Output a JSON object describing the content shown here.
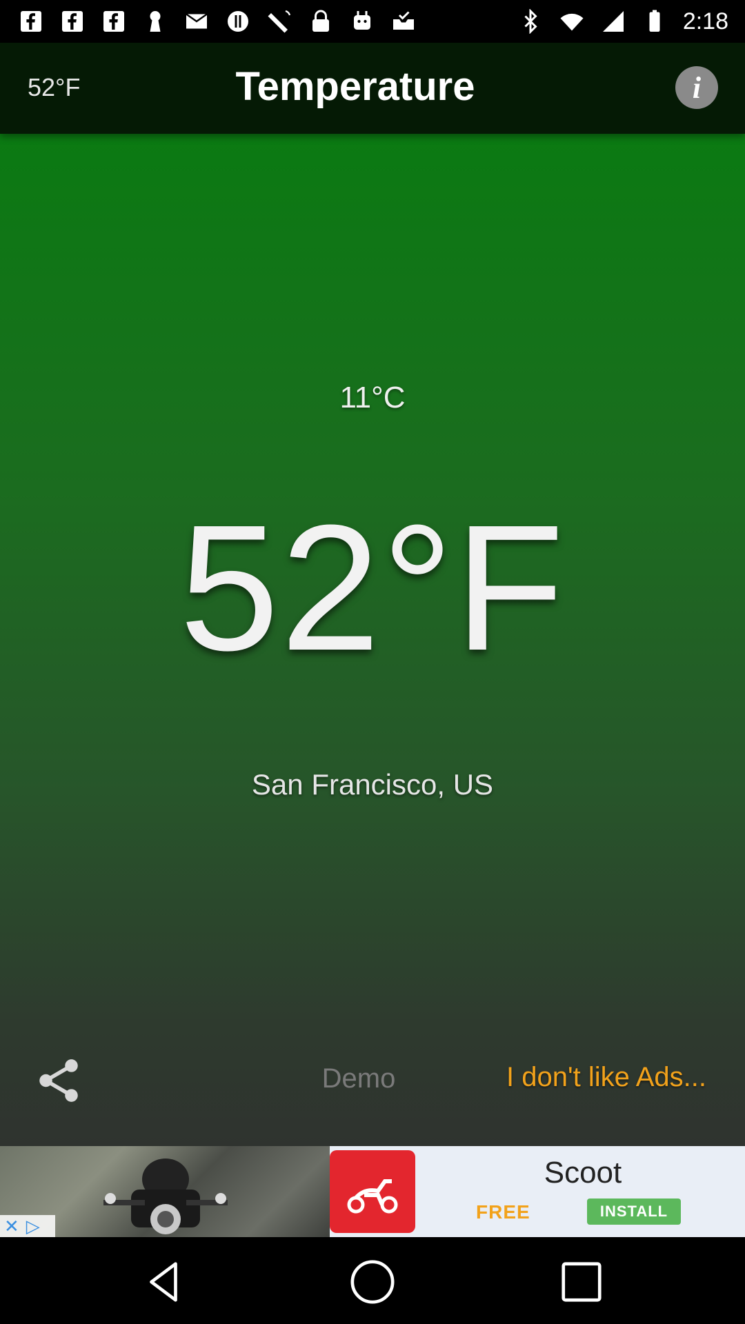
{
  "status_bar": {
    "time": "2:18",
    "icons": [
      "facebook-icon",
      "facebook-icon",
      "facebook-icon",
      "keyhole-icon",
      "mail-icon",
      "alert-icon",
      "satellite-icon",
      "lock-icon",
      "android-icon",
      "inbox-check-icon",
      "bluetooth-icon",
      "wifi-icon",
      "signal-icon",
      "battery-icon"
    ]
  },
  "toolbar": {
    "temp_short": "52°F",
    "title": "Temperature",
    "info_label": "i"
  },
  "weather": {
    "celsius": "11°C",
    "fahrenheit": "52°F",
    "location": "San Francisco, US"
  },
  "footer": {
    "demo_label": "Demo",
    "no_ads_label": "I don't like Ads..."
  },
  "ad": {
    "app_name": "Scoot",
    "free_label": "FREE",
    "install_label": "INSTALL"
  },
  "colors": {
    "accent_orange": "#f2a21b",
    "install_green": "#5cb85c",
    "logo_red": "#e3262e"
  }
}
